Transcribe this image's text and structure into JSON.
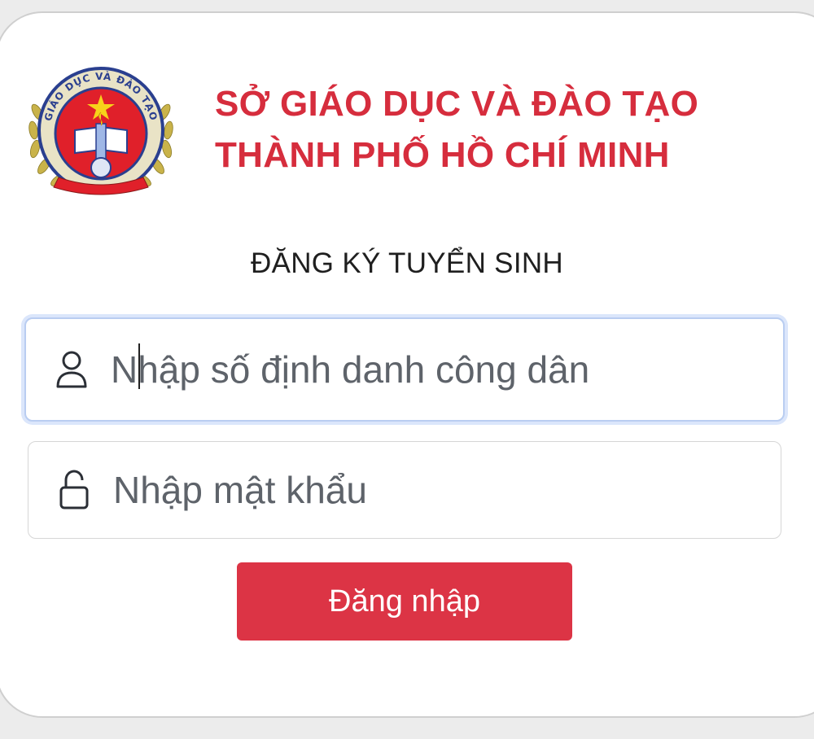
{
  "header": {
    "org_line1": "SỞ GIÁO DỤC VÀ ĐÀO TẠO",
    "org_line2": "THÀNH PHỐ HỒ CHÍ MINH",
    "logo_ring_text": "GIÁO DỤC VÀ ĐÀO TẠO"
  },
  "form": {
    "title": "ĐĂNG KÝ TUYỂN SINH",
    "id_field": {
      "placeholder": "Nhập số định danh công dân",
      "value": "",
      "icon": "user-icon"
    },
    "password_field": {
      "placeholder": "Nhập mật khẩu",
      "value": "",
      "icon": "lock-icon"
    },
    "submit_label": "Đăng nhập"
  },
  "colors": {
    "brand_red": "#d62d3d",
    "button_red": "#dc3445",
    "focus_ring": "#b9cdf1"
  }
}
